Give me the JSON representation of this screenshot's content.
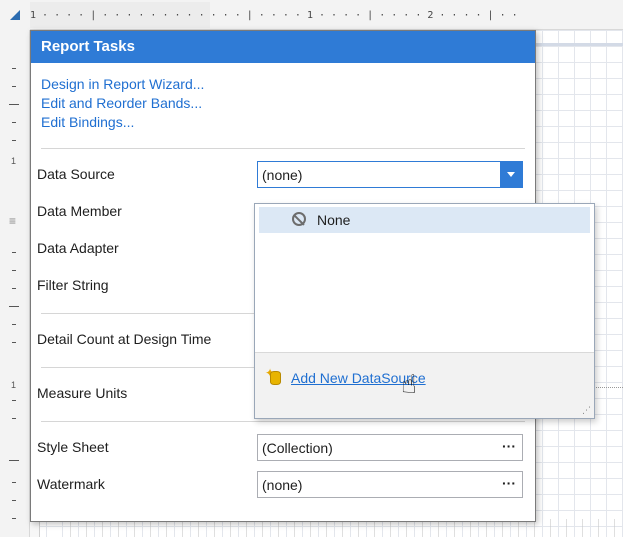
{
  "ruler": {
    "top_ticks": "1 · · · · | · · · · · · · · · · · · | · · · · 1 · · · · | · · · · 2 · · · · | · ·",
    "left_numbers": [
      "1",
      "1"
    ]
  },
  "panel": {
    "title": "Report Tasks",
    "links": [
      "Design in Report Wizard...",
      "Edit and Reorder Bands...",
      "Edit Bindings..."
    ],
    "properties": {
      "data_source": {
        "label": "Data Source",
        "value": "(none)"
      },
      "data_member": {
        "label": "Data Member"
      },
      "data_adapter": {
        "label": "Data Adapter"
      },
      "filter_string": {
        "label": "Filter String"
      },
      "detail_count": {
        "label": "Detail Count at Design Time"
      },
      "measure_units": {
        "label": "Measure Units"
      },
      "style_sheet": {
        "label": "Style Sheet",
        "value": "(Collection)",
        "button": "···"
      },
      "watermark": {
        "label": "Watermark",
        "value": "(none)",
        "button": "···"
      }
    }
  },
  "popup": {
    "selected_item": "None",
    "add_link": "Add New DataSource",
    "resize_grip": "⋰"
  },
  "colors": {
    "accent": "#2f7bd6",
    "link": "#1f6fd1",
    "selection": "#dce8f5"
  }
}
